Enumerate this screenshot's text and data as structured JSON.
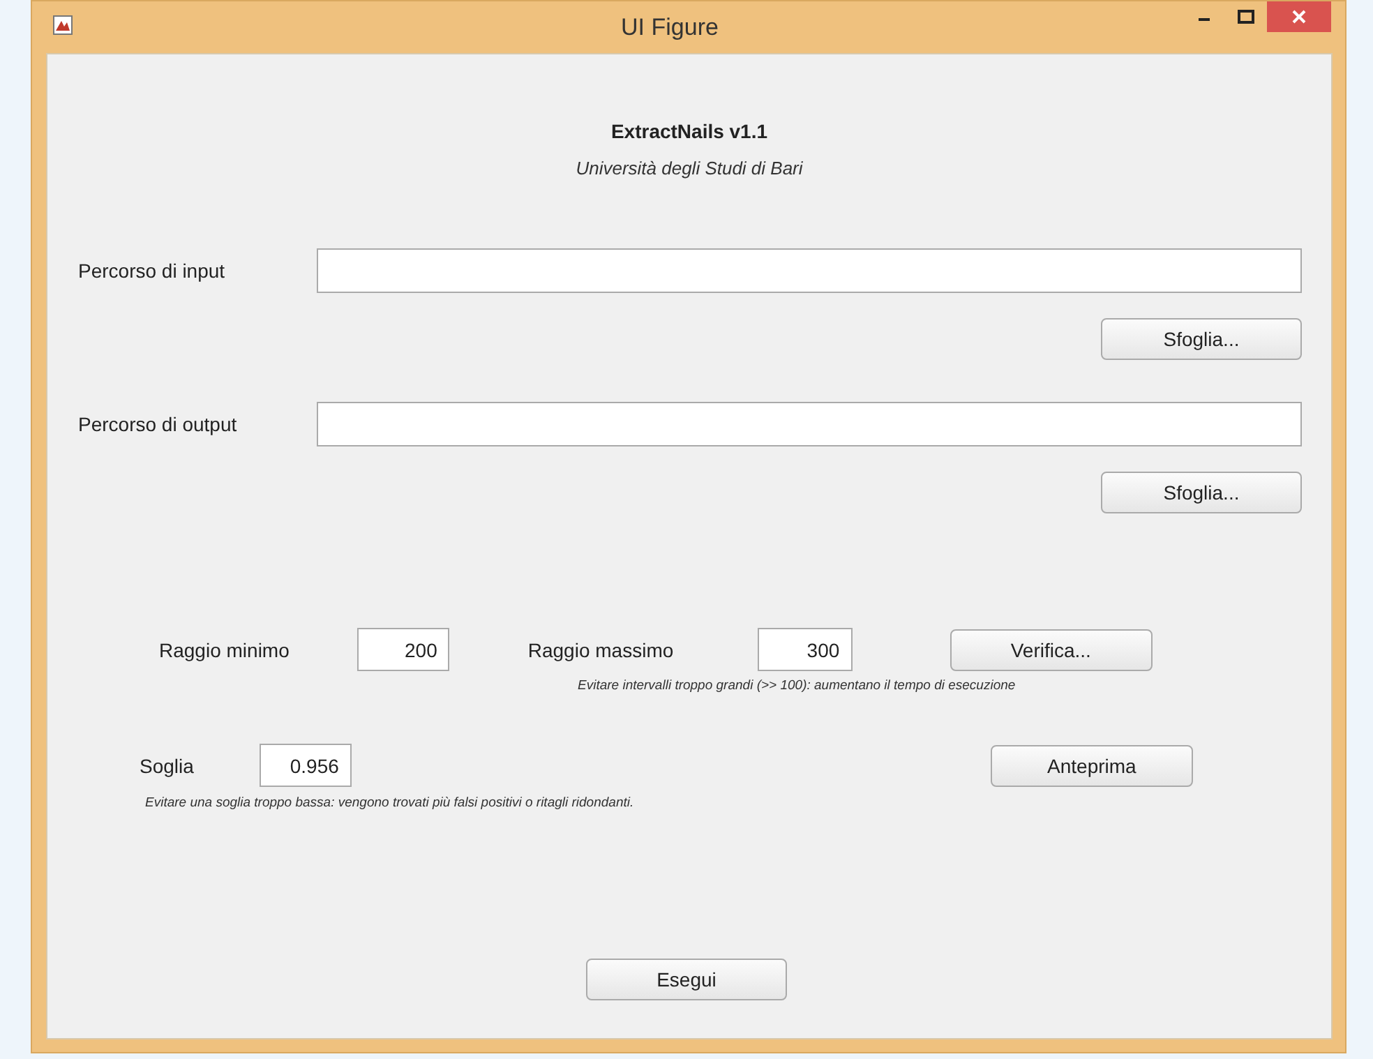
{
  "window": {
    "title": "UI Figure"
  },
  "header": {
    "title": "ExtractNails v1.1",
    "subtitle": "Università degli Studi di Bari"
  },
  "paths": [
    {
      "label": "Percorso di input",
      "button": "Sfoglia..."
    },
    {
      "label": "Percorso di output",
      "button": "Sfoglia..."
    }
  ],
  "radius": {
    "min_label": "Raggio minimo",
    "min_value": "200",
    "max_label": "Raggio massimo",
    "max_value": "300",
    "button": "Verifica...",
    "hint": "Evitare intervalli troppo grandi (>> 100): aumentano il tempo di esecuzione"
  },
  "threshold": {
    "label": "Soglia",
    "value": "0.956",
    "button": "Anteprima",
    "hint": "Evitare una soglia troppo bassa: vengono trovati più falsi positivi o ritagli ridondanti."
  },
  "run_button": "Esegui"
}
